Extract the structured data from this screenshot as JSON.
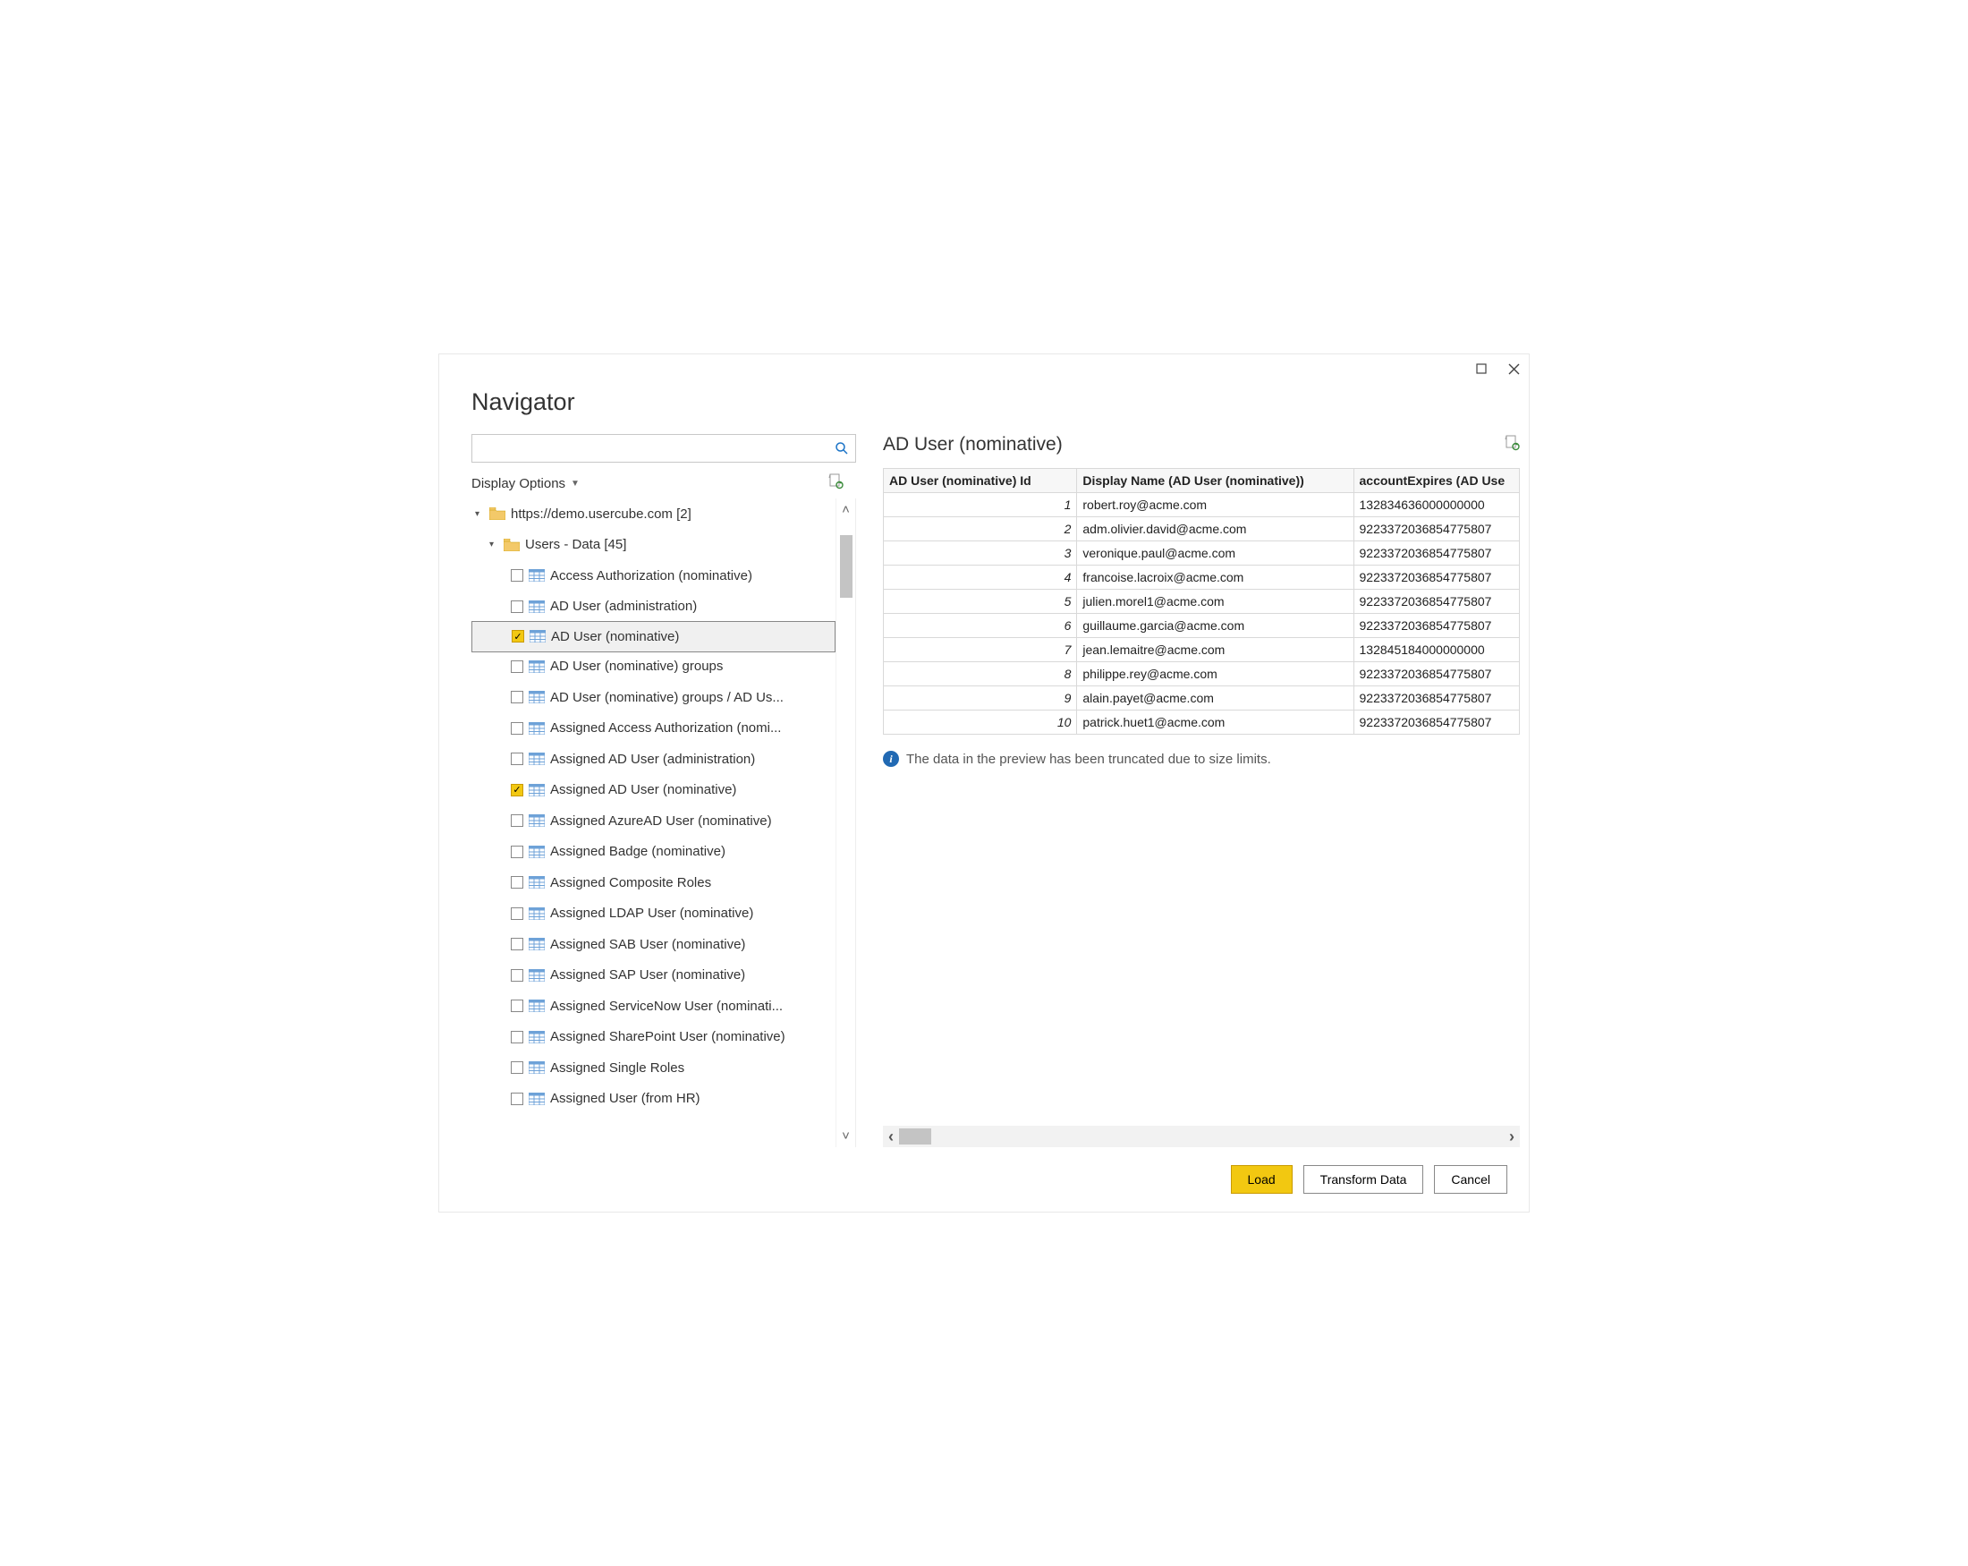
{
  "window": {
    "title": "Navigator"
  },
  "search": {
    "placeholder": ""
  },
  "display_options_label": "Display Options",
  "tree": {
    "root": {
      "label": "https://demo.usercube.com [2]"
    },
    "group": {
      "label": "Users - Data [45]"
    },
    "items": [
      {
        "label": "Access Authorization (nominative)",
        "checked": false
      },
      {
        "label": "AD User (administration)",
        "checked": false
      },
      {
        "label": "AD User (nominative)",
        "checked": true,
        "selected": true
      },
      {
        "label": "AD User (nominative) groups",
        "checked": false
      },
      {
        "label": "AD User (nominative) groups / AD Us...",
        "checked": false
      },
      {
        "label": "Assigned Access Authorization (nomi...",
        "checked": false
      },
      {
        "label": "Assigned AD User (administration)",
        "checked": false
      },
      {
        "label": "Assigned AD User (nominative)",
        "checked": true
      },
      {
        "label": "Assigned AzureAD User (nominative)",
        "checked": false
      },
      {
        "label": "Assigned Badge (nominative)",
        "checked": false
      },
      {
        "label": "Assigned Composite Roles",
        "checked": false
      },
      {
        "label": "Assigned LDAP User (nominative)",
        "checked": false
      },
      {
        "label": "Assigned SAB User (nominative)",
        "checked": false
      },
      {
        "label": "Assigned SAP User (nominative)",
        "checked": false
      },
      {
        "label": "Assigned ServiceNow User (nominati...",
        "checked": false
      },
      {
        "label": "Assigned SharePoint User (nominative)",
        "checked": false
      },
      {
        "label": "Assigned Single Roles",
        "checked": false
      },
      {
        "label": "Assigned User (from HR)",
        "checked": false
      }
    ]
  },
  "preview": {
    "title": "AD User (nominative)",
    "columns": [
      "AD User (nominative) Id",
      "Display Name (AD User (nominative))",
      "accountExpires (AD Use"
    ],
    "rows": [
      {
        "id": "1",
        "display": "robert.roy@acme.com",
        "exp": "132834636000000000"
      },
      {
        "id": "2",
        "display": "adm.olivier.david@acme.com",
        "exp": "9223372036854775807"
      },
      {
        "id": "3",
        "display": "veronique.paul@acme.com",
        "exp": "9223372036854775807"
      },
      {
        "id": "4",
        "display": "francoise.lacroix@acme.com",
        "exp": "9223372036854775807"
      },
      {
        "id": "5",
        "display": "julien.morel1@acme.com",
        "exp": "9223372036854775807"
      },
      {
        "id": "6",
        "display": "guillaume.garcia@acme.com",
        "exp": "9223372036854775807"
      },
      {
        "id": "7",
        "display": "jean.lemaitre@acme.com",
        "exp": "132845184000000000"
      },
      {
        "id": "8",
        "display": "philippe.rey@acme.com",
        "exp": "9223372036854775807"
      },
      {
        "id": "9",
        "display": "alain.payet@acme.com",
        "exp": "9223372036854775807"
      },
      {
        "id": "10",
        "display": "patrick.huet1@acme.com",
        "exp": "9223372036854775807"
      }
    ],
    "truncation_note": "The data in the preview has been truncated due to size limits."
  },
  "buttons": {
    "load": "Load",
    "transform": "Transform Data",
    "cancel": "Cancel"
  }
}
